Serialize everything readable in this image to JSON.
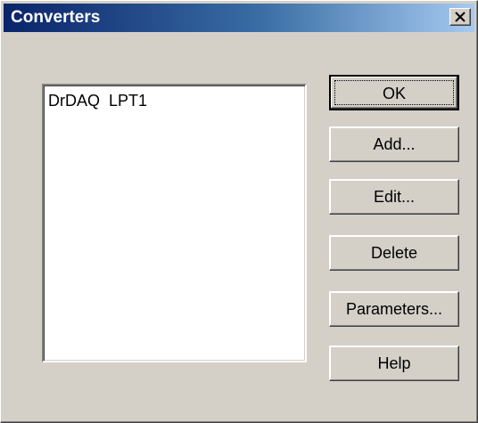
{
  "window": {
    "title": "Converters"
  },
  "listbox": {
    "items": [
      "DrDAQ  LPT1"
    ]
  },
  "buttons": {
    "ok": "OK",
    "add": "Add...",
    "edit": "Edit...",
    "delete": "Delete",
    "parameters": "Parameters...",
    "help": "Help"
  },
  "icons": {
    "close": "close-icon"
  },
  "colors": {
    "titlebar_start": "#0a246a",
    "titlebar_end": "#a6caf0",
    "face": "#d4d0c8"
  }
}
